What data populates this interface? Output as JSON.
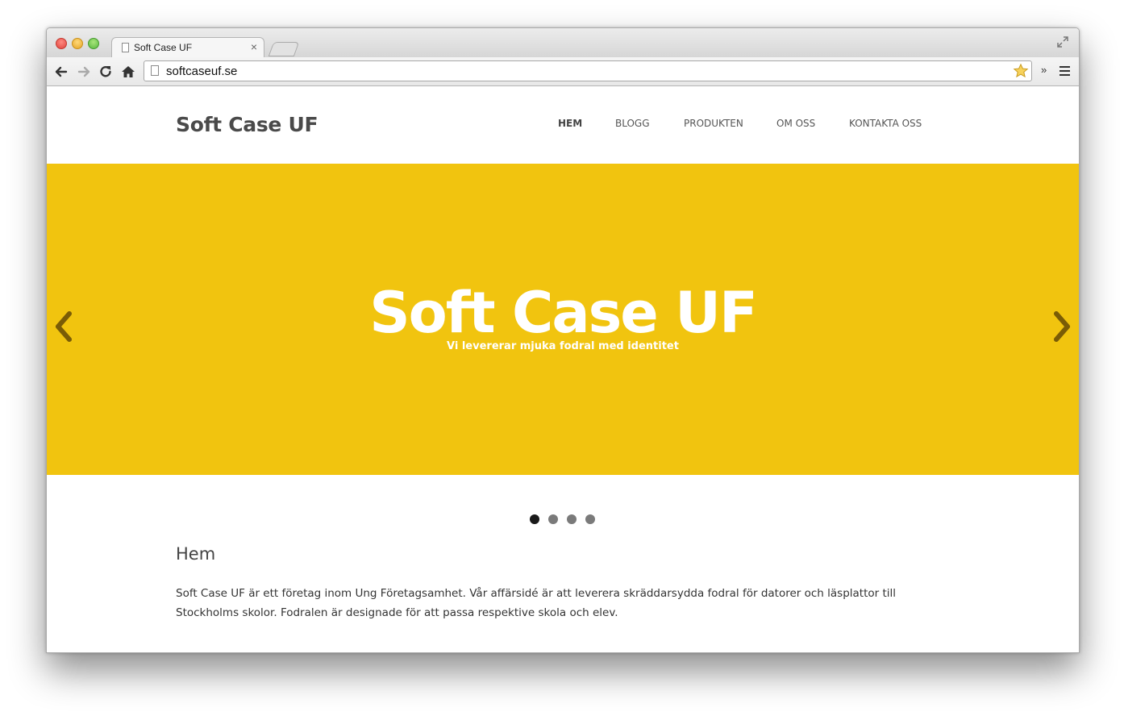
{
  "browser": {
    "tab_title": "Soft Case UF",
    "tab_close": "×",
    "url": "softcaseuf.se",
    "extensions_more": "»"
  },
  "site": {
    "title": "Soft Case UF",
    "nav": [
      {
        "label": "HEM",
        "active": true
      },
      {
        "label": "BLOGG"
      },
      {
        "label": "PRODUKTEN"
      },
      {
        "label": "OM OSS"
      },
      {
        "label": "KONTAKTA OSS"
      }
    ]
  },
  "slider": {
    "title": "Soft Case UF",
    "subtitle": "Vi levererar mjuka fodral med identitet",
    "background_color": "#f1c40f",
    "arrow_color": "#7a5c06",
    "slide_count": 4,
    "active_slide": 1
  },
  "content": {
    "heading": "Hem",
    "text": "Soft Case UF är ett företag inom Ung Företagsamhet. Vår affärsidé är att leverera skräddarsydda fodral för datorer och läsplattor till Stockholms skolor. Fodralen är designade för att passa respektive skola och elev."
  }
}
